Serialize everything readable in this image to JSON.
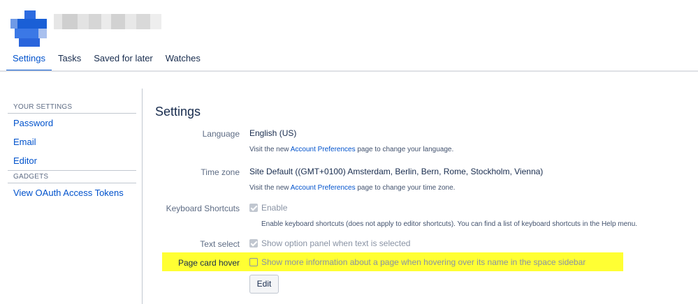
{
  "tabs": [
    {
      "label": "Settings",
      "active": true
    },
    {
      "label": "Tasks",
      "active": false
    },
    {
      "label": "Saved for later",
      "active": false
    },
    {
      "label": "Watches",
      "active": false
    }
  ],
  "sidebar": {
    "your_settings_heading": "YOUR SETTINGS",
    "items": [
      {
        "label": "Password"
      },
      {
        "label": "Email"
      },
      {
        "label": "Editor"
      }
    ],
    "gadgets_heading": "GADGETS",
    "gadget_items": [
      {
        "label": "View OAuth Access Tokens"
      }
    ]
  },
  "main": {
    "title": "Settings",
    "language": {
      "label": "Language",
      "value": "English (US)",
      "desc_prefix": "Visit the new ",
      "desc_link": "Account Preferences",
      "desc_suffix": " page to change your language."
    },
    "timezone": {
      "label": "Time zone",
      "value": "Site Default ((GMT+0100) Amsterdam, Berlin, Bern, Rome, Stockholm, Vienna)",
      "desc_prefix": "Visit the new ",
      "desc_link": "Account Preferences",
      "desc_suffix": " page to change your time zone."
    },
    "keyboard": {
      "label": "Keyboard Shortcuts",
      "checkbox_label": "Enable",
      "checked": true,
      "desc": "Enable keyboard shortcuts (does not apply to editor shortcuts). You can find a list of keyboard shortcuts in the Help menu."
    },
    "text_select": {
      "label": "Text select",
      "checkbox_label": "Show option panel when text is selected",
      "checked": true
    },
    "page_card_hover": {
      "label": "Page card hover",
      "checkbox_label": "Show more information about a page when hovering over its name in the space sidebar",
      "checked": false
    },
    "edit_button": "Edit"
  },
  "colors": {
    "accent": "#0052cc",
    "highlight": "#ffff33",
    "avatar_blue": "#1a5fd6"
  }
}
